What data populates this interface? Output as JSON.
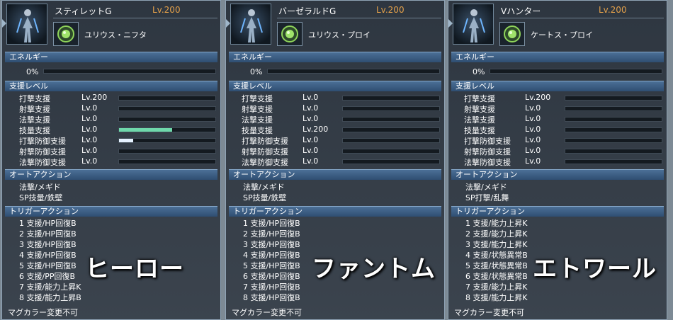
{
  "section_labels": {
    "energy": "エネルギー",
    "support": "支援レベル",
    "auto": "オートアクション",
    "trigger": "トリガーアクション"
  },
  "footer": "マグカラー変更不可",
  "energy_text": "0%",
  "support_names": [
    "打撃支援",
    "射撃支援",
    "法撃支援",
    "技量支援",
    "打撃防御支援",
    "射撃防御支援",
    "法撃防御支援"
  ],
  "panels": [
    {
      "title": "スティレットG",
      "level": "Lv.200",
      "mag": "ユリウス・ニフタ",
      "mag_icon": "green-orb-icon",
      "energy": 0,
      "support": [
        {
          "lv": "Lv.200",
          "fill": 0
        },
        {
          "lv": "Lv.0",
          "fill": 0
        },
        {
          "lv": "Lv.0",
          "fill": 0
        },
        {
          "lv": "Lv.0",
          "fill": 0.55,
          "color": "#6fd8ab"
        },
        {
          "lv": "Lv.0",
          "fill": 0.15,
          "color": "#e6f2ff"
        },
        {
          "lv": "Lv.0",
          "fill": 0
        },
        {
          "lv": "Lv.0",
          "fill": 0
        }
      ],
      "auto": [
        "法撃/メギド",
        "SP技量/鉄壁"
      ],
      "trigger": [
        "1 支援/HP回復B",
        "2 支援/HP回復B",
        "3 支援/HP回復B",
        "4 支援/HP回復B",
        "5 支援/HP回復B",
        "6 支援/PP回復B",
        "7 支援/能力上昇K",
        "8 支援/能力上昇B"
      ],
      "class_label": "ヒーロー"
    },
    {
      "title": "バーゼラルドG",
      "level": "Lv.200",
      "mag": "ユリウス・プロイ",
      "mag_icon": "green-orb-icon",
      "energy": 0,
      "support": [
        {
          "lv": "Lv.0",
          "fill": 0
        },
        {
          "lv": "Lv.0",
          "fill": 0
        },
        {
          "lv": "Lv.0",
          "fill": 0
        },
        {
          "lv": "Lv.200",
          "fill": 0
        },
        {
          "lv": "Lv.0",
          "fill": 0
        },
        {
          "lv": "Lv.0",
          "fill": 0
        },
        {
          "lv": "Lv.0",
          "fill": 0
        }
      ],
      "auto": [
        "法撃/メギド",
        "SP技量/鉄壁"
      ],
      "trigger": [
        "1 支援/HP回復B",
        "2 支援/HP回復B",
        "3 支援/HP回復B",
        "4 支援/HP回復B",
        "5 支援/HP回復B",
        "6 支援/HP回復B",
        "7 支援/HP回復B",
        "8 支援/HP回復B"
      ],
      "class_label": "ファントム"
    },
    {
      "title": "Vハンター",
      "level": "Lv.200",
      "mag": "ケートス・プロイ",
      "mag_icon": "green-orb-icon",
      "energy": 0,
      "support": [
        {
          "lv": "Lv.200",
          "fill": 0
        },
        {
          "lv": "Lv.0",
          "fill": 0
        },
        {
          "lv": "Lv.0",
          "fill": 0
        },
        {
          "lv": "Lv.0",
          "fill": 0
        },
        {
          "lv": "Lv.0",
          "fill": 0
        },
        {
          "lv": "Lv.0",
          "fill": 0
        },
        {
          "lv": "Lv.0",
          "fill": 0
        }
      ],
      "auto": [
        "法撃/メギド",
        "SP打撃/乱舞"
      ],
      "trigger": [
        "1 支援/能力上昇K",
        "2 支援/能力上昇K",
        "3 支援/能力上昇K",
        "4 支援/状態異常B",
        "5 支援/状態異常B",
        "6 支援/状態異常B",
        "7 支援/能力上昇K",
        "8 支援/能力上昇K"
      ],
      "class_label": "エトワール"
    }
  ]
}
